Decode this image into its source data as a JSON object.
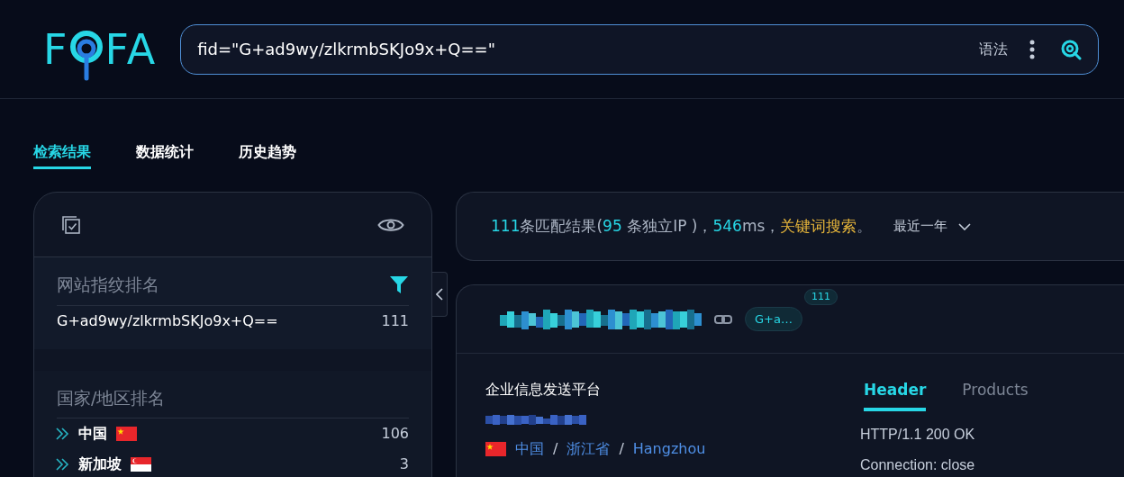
{
  "logo": {
    "text_before": "F",
    "text_after": "FA"
  },
  "search": {
    "value": "fid=\"G+ad9wy/zlkrmbSKJo9x+Q==\"",
    "syntax_label": "语法"
  },
  "tabs": [
    {
      "label": "检索结果",
      "selected": true
    },
    {
      "label": "数据统计",
      "selected": false
    },
    {
      "label": "历史趋势",
      "selected": false
    }
  ],
  "sidebar": {
    "sections": [
      {
        "title": "网站指纹排名",
        "filter": true,
        "rows": [
          {
            "label": "G+ad9wy/zlkrmbSKJo9x+Q==",
            "count": "111"
          }
        ]
      },
      {
        "title": "国家/地区排名",
        "filter": false,
        "rows": [
          {
            "label": "中国",
            "count": "106",
            "flag": {
              "kind": "cn"
            }
          },
          {
            "label": "新加坡",
            "count": "3",
            "flag": {
              "kind": "sg"
            }
          }
        ]
      }
    ]
  },
  "summary": {
    "segments": [
      {
        "kind": "number",
        "text": "111"
      },
      {
        "kind": "text",
        "text": "条匹配结果("
      },
      {
        "kind": "number",
        "text": "95"
      },
      {
        "kind": "text",
        "text": " 条独立IP )，"
      },
      {
        "kind": "number",
        "text": "546"
      },
      {
        "kind": "text",
        "text": "ms，"
      },
      {
        "kind": "keyword",
        "text": "关键词搜索"
      },
      {
        "kind": "text",
        "text": "。"
      }
    ],
    "range": "最近一年"
  },
  "result": {
    "tag": "G+a…",
    "tag_count": "111",
    "title": "企业信息发送平台",
    "location": [
      {
        "text": "中国"
      },
      {
        "separator": "/",
        "text": "浙江省"
      },
      {
        "separator": "/",
        "text": "Hangzhou"
      }
    ],
    "flag": {
      "kind": "cn"
    },
    "tabs": [
      {
        "label": "Header",
        "selected": true
      },
      {
        "label": "Products",
        "selected": false
      }
    ],
    "header_lines": [
      "HTTP/1.1 200 OK",
      "Connection: close"
    ]
  }
}
